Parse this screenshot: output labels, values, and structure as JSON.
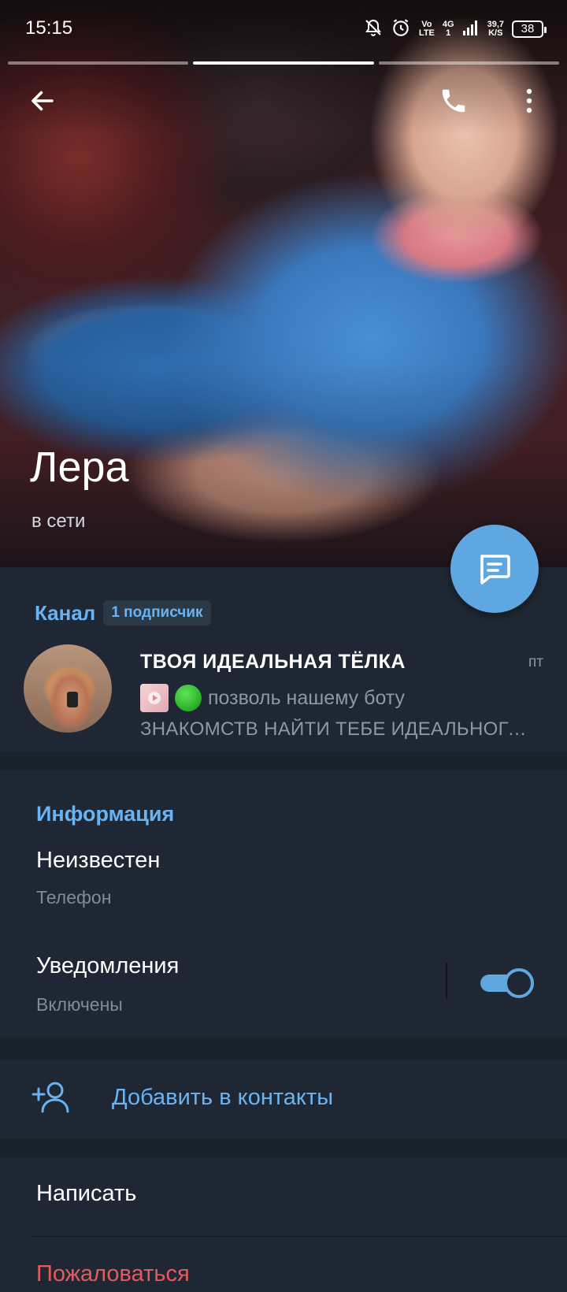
{
  "status_bar": {
    "time": "15:15",
    "network_volte_top": "Vo",
    "network_volte_bottom": "LTE",
    "network_4g_top": "4G",
    "network_4g_bottom": "1",
    "speed_top": "39,7",
    "speed_bottom": "K/S",
    "battery": "38"
  },
  "story_progress": {
    "count": 3,
    "active_index": 1
  },
  "profile": {
    "name": "Лера",
    "status": "в сети"
  },
  "channel": {
    "label": "Канал",
    "subscribers_badge": "1 подписчик",
    "title": "ТВОЯ ИДЕАЛЬНАЯ ТЁЛКА",
    "time": "пт",
    "preview_line1": "позволь нашему боту",
    "preview_line2": "ЗНАКОМСТВ НАЙТИ ТЕБЕ ИДЕАЛЬНОГО…"
  },
  "info": {
    "header": "Информация",
    "phone_value": "Неизвестен",
    "phone_label": "Телефон",
    "notifications_value": "Уведомления",
    "notifications_label": "Включены",
    "notifications_enabled": true
  },
  "actions": {
    "add_contact": "Добавить в контакты",
    "write": "Написать",
    "report": "Пожаловаться"
  },
  "colors": {
    "accent": "#6ab3f3",
    "fab": "#5fa7e0",
    "background": "#1a222c",
    "section": "#1e2733",
    "danger": "#e35b5b"
  },
  "icons": {
    "back": "arrow-left-icon",
    "call": "phone-icon",
    "more": "more-vertical-icon",
    "message": "message-icon",
    "add_contact": "add-user-icon"
  }
}
